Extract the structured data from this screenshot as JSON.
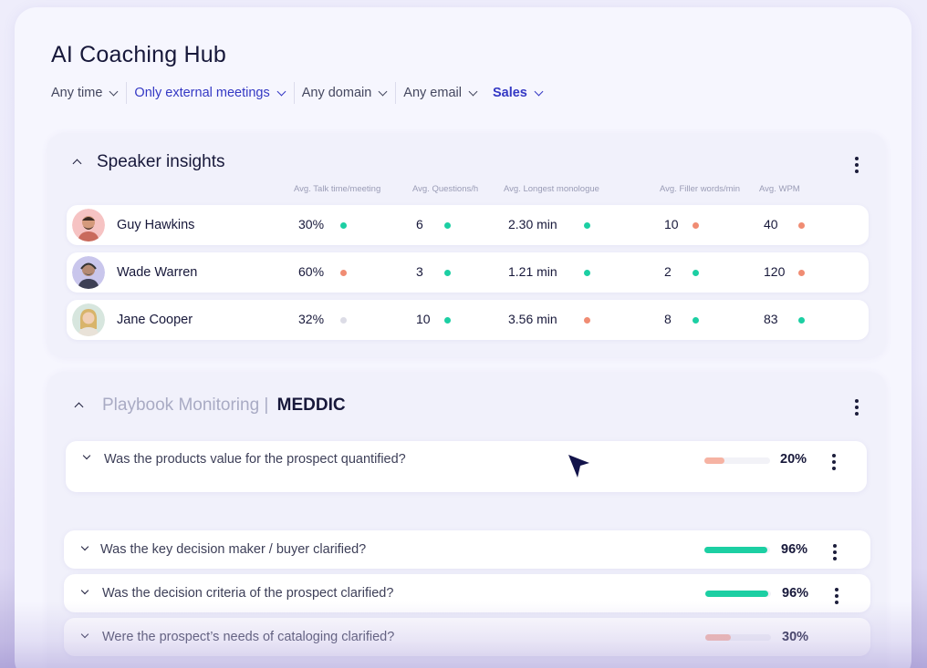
{
  "title": "AI Coaching Hub",
  "filters": [
    {
      "label": "Any time"
    },
    {
      "label": "Only external meetings"
    },
    {
      "label": "Any domain"
    },
    {
      "label": "Any email"
    },
    {
      "label": "Sales"
    }
  ],
  "speaker_insights": {
    "title": "Speaker insights",
    "columns": [
      "Avg. Talk time/meeting",
      "Avg. Questions/h",
      "Avg. Longest monologue",
      "Avg. Filler words/min",
      "Avg. WPM"
    ],
    "rows": [
      {
        "name": "Guy Hawkins",
        "values": [
          "30%",
          "6",
          "2.30 min",
          "10",
          "40"
        ],
        "status": [
          "green",
          "green",
          "green",
          "red",
          "red"
        ]
      },
      {
        "name": "Wade Warren",
        "values": [
          "60%",
          "3",
          "1.21 min",
          "2",
          "120"
        ],
        "status": [
          "red",
          "green",
          "green",
          "green",
          "red"
        ]
      },
      {
        "name": "Jane Cooper",
        "values": [
          "32%",
          "10",
          "3.56 min",
          "8",
          "83"
        ],
        "status": [
          "gray",
          "green",
          "red",
          "green",
          "green"
        ]
      }
    ]
  },
  "playbook": {
    "title_prefix": "Playbook Monitoring |",
    "title_method": "MEDDIC",
    "questions": [
      {
        "text": "Was the products value for the prospect quantified?",
        "percent_label": "20%",
        "percent": 20,
        "color": "red"
      },
      {
        "text": "Was the key decision maker / buyer clarified?",
        "percent_label": "96%",
        "percent": 96,
        "color": "green"
      },
      {
        "text": "Was the decision criteria of the prospect clarified?",
        "percent_label": "96%",
        "percent": 96,
        "color": "green"
      },
      {
        "text": "Were the prospect’s needs of cataloging clarified?",
        "percent_label": "30%",
        "percent": 30,
        "color": "red"
      }
    ]
  },
  "colors": {
    "green": "#1ccfa3",
    "red": "#f08c73",
    "gray": "#dcdce6",
    "accent": "#3438c4"
  }
}
